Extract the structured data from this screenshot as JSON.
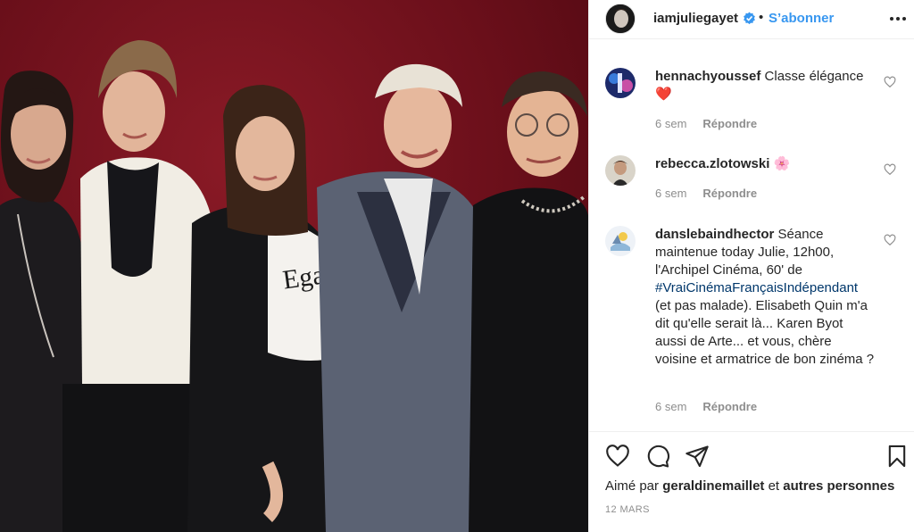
{
  "post": {
    "username": "iamjuliegayet",
    "separator": "•",
    "follow_label": "S’abonner",
    "verified_icon": "verified-badge-icon",
    "more_icon": "more-options-icon"
  },
  "comments": [
    {
      "username": "hennachyoussef",
      "text": "Classe élégance",
      "emoji": "❤️",
      "age": "6 sem",
      "reply_label": "Répondre"
    },
    {
      "username": "rebecca.zlotowski",
      "text": "",
      "emoji": "🌸",
      "age": "6 sem",
      "reply_label": "Répondre"
    },
    {
      "username": "danslebaindhector",
      "text_before": "Séance maintenue today Julie, 12h00, l'Archipel Cinéma, 60' de",
      "hashtag": "#VraiCinémaFrançaisIndépendant",
      "text_after": "(et pas malade). Elisabeth Quin m'a dit qu'elle serait là... Karen Byot aussi de Arte... et vous, chère voisine et armatrice de bon zinéma ?",
      "age": "6 sem",
      "reply_label": "Répondre"
    }
  ],
  "actions": {
    "icons": [
      "heart-icon",
      "comment-icon",
      "share-icon",
      "save-icon"
    ],
    "liked_prefix": "Aimé par",
    "liked_user": "geraldinemaillet",
    "liked_and": "et",
    "liked_others": "autres personnes",
    "date": "12 MARS"
  },
  "colors": {
    "link_blue": "#3897f0",
    "hashtag": "#00376b",
    "muted": "#8e8e8e",
    "photo_backdrop": "#6a0f1a"
  }
}
